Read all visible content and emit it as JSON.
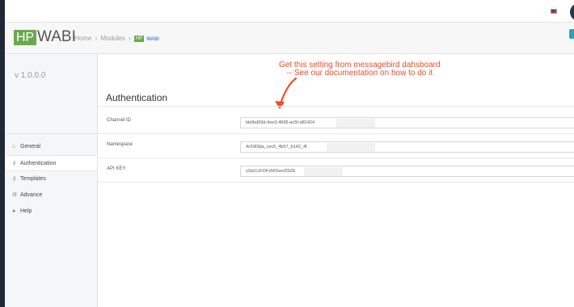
{
  "app": {
    "logo": "HP",
    "name": "WABI",
    "version": "v 1.0.0.0"
  },
  "breadcrumb": {
    "home": "Home",
    "modules": "Modules",
    "badge": "HP",
    "current": "WABI",
    "separator": "›"
  },
  "sidebar": {
    "items": [
      {
        "label": "General",
        "icon": "home-icon"
      },
      {
        "label": "Authentication",
        "icon": "key-icon"
      },
      {
        "label": "Templates",
        "icon": "key-icon"
      },
      {
        "label": "Advance",
        "icon": "gears-icon"
      },
      {
        "label": "Help",
        "icon": "help-circle-icon"
      }
    ]
  },
  "annotation": {
    "line1": "Get this setting from messagebird dahsboard",
    "line2": "-- See our documentation on how to do it",
    "color": "#ef4a2a"
  },
  "section": {
    "title": "Authentication"
  },
  "fields": {
    "channel": {
      "label": "Channel ID",
      "value": "bb0bd93d-9ee3-4695-ac5f-d81424"
    },
    "namespace": {
      "label": "Namespace",
      "value": "4c59f3da_cec5_4b57_b142_4f"
    },
    "apikey": {
      "label": "API KEY",
      "value": "zSlzCcFOFx56SwcD5ZE"
    }
  },
  "colors": {
    "accent": "#6aa84f",
    "link": "#4a8fd6",
    "dark_rail": "#1f2a36"
  }
}
